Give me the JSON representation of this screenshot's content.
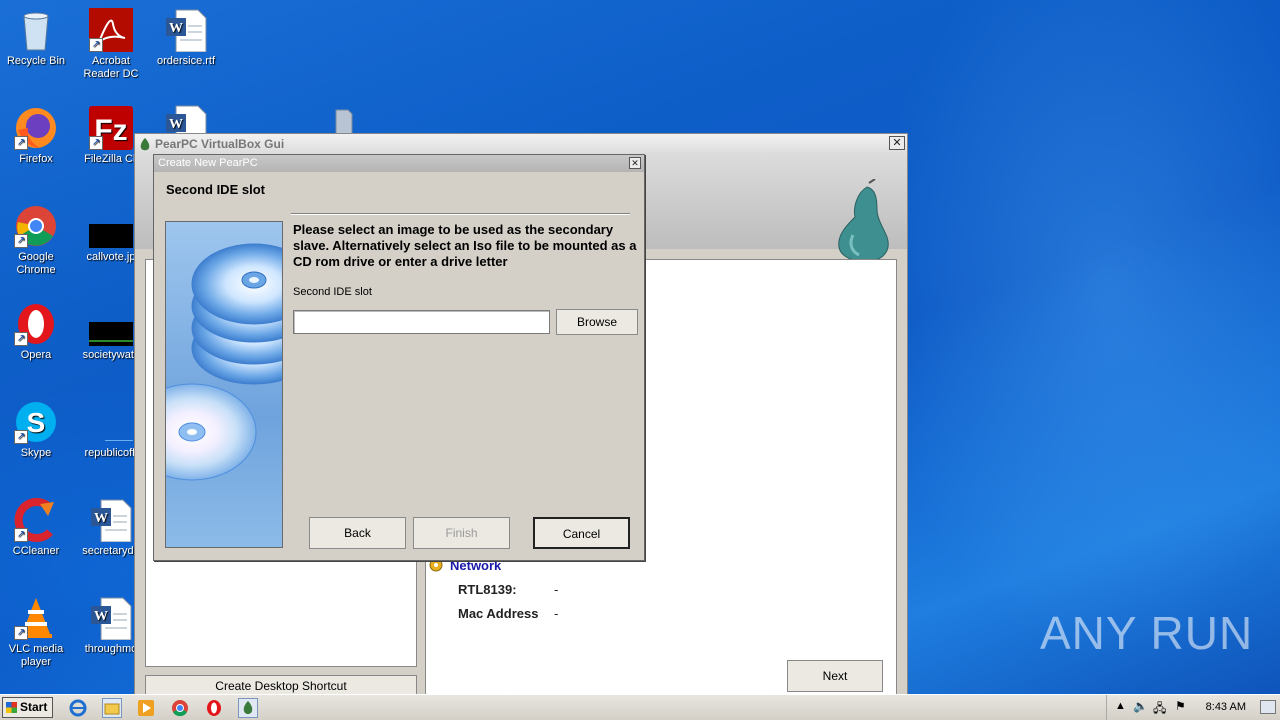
{
  "desktop_icons": [
    {
      "name": "recycle-bin",
      "label": "Recycle Bin"
    },
    {
      "name": "acrobat-reader",
      "label": "Acrobat Reader DC"
    },
    {
      "name": "ordersice",
      "label": "ordersice.rtf"
    },
    {
      "name": "firefox",
      "label": "Firefox"
    },
    {
      "name": "filezilla",
      "label": "FileZilla Cli"
    },
    {
      "name": "chrome",
      "label": "Google Chrome"
    },
    {
      "name": "callvote",
      "label": "callvote.jp"
    },
    {
      "name": "opera",
      "label": "Opera"
    },
    {
      "name": "societywatc",
      "label": "societywatc"
    },
    {
      "name": "skype",
      "label": "Skype"
    },
    {
      "name": "republicoffi",
      "label": "republicoffi"
    },
    {
      "name": "ccleaner",
      "label": "CCleaner"
    },
    {
      "name": "secretaryde",
      "label": "secretaryde"
    },
    {
      "name": "vlc",
      "label": "VLC media player"
    },
    {
      "name": "throughmo",
      "label": "throughmo"
    }
  ],
  "main_window": {
    "title": "PearPC VirtualBox Gui",
    "network_heading": "Network",
    "rtl_label": "RTL8139:",
    "rtl_value": "-",
    "mac_label": "Mac Address",
    "mac_value": "-",
    "shortcut_button": "Create Desktop Shortcut",
    "next_button": "Next"
  },
  "dialog": {
    "title": "Create New PearPC",
    "heading": "Second IDE slot",
    "instructions": "Please select an image to be used as the secondary slave. Alternatively select an Iso file to be mounted as a CD rom drive or enter a drive letter",
    "field_label": "Second IDE slot",
    "field_value": "",
    "browse_button": "Browse",
    "back_button": "Back",
    "finish_button": "Finish",
    "cancel_button": "Cancel"
  },
  "taskbar": {
    "start_label": "Start",
    "clock": "8:43 AM"
  },
  "watermark": "ANY RUN"
}
